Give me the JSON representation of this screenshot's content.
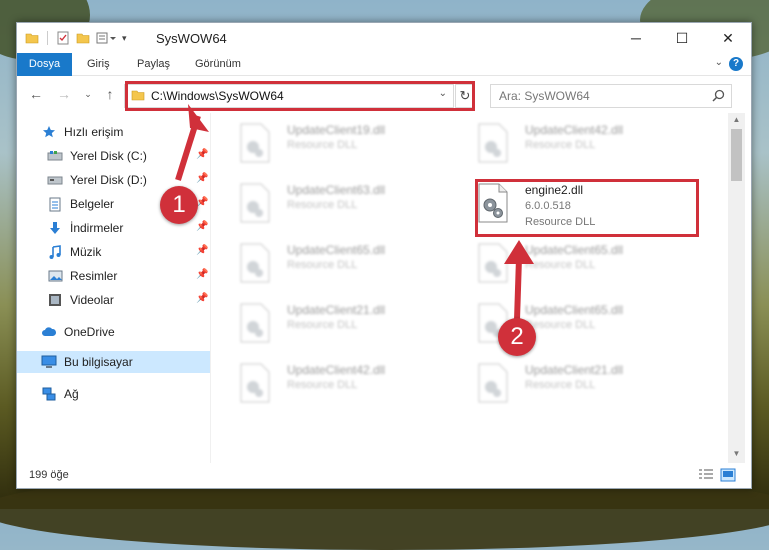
{
  "window": {
    "title": "SysWOW64",
    "controls": {
      "minimize": "─",
      "maximize": "☐",
      "close": "✕"
    }
  },
  "ribbon": {
    "tabs": [
      {
        "label": "Dosya"
      },
      {
        "label": "Giriş"
      },
      {
        "label": "Paylaş"
      },
      {
        "label": "Görünüm"
      }
    ],
    "help": "?"
  },
  "navigation": {
    "address": "C:\\Windows\\SysWOW64",
    "search_placeholder": "Ara: SysWOW64"
  },
  "sidebar": {
    "items": [
      {
        "label": "Hızlı erişim",
        "icon": "star-icon"
      },
      {
        "label": "Yerel Disk (C:)",
        "icon": "drive-icon"
      },
      {
        "label": "Yerel Disk (D:)",
        "icon": "drive-icon"
      },
      {
        "label": "Belgeler",
        "icon": "documents-icon"
      },
      {
        "label": "İndirmeler",
        "icon": "download-icon"
      },
      {
        "label": "Müzik",
        "icon": "music-icon"
      },
      {
        "label": "Resimler",
        "icon": "pictures-icon"
      },
      {
        "label": "Videolar",
        "icon": "video-icon"
      },
      {
        "label": "OneDrive",
        "icon": "cloud-icon"
      },
      {
        "label": "Bu bilgisayar",
        "icon": "computer-icon"
      },
      {
        "label": "Ağ",
        "icon": "network-icon"
      }
    ]
  },
  "files": {
    "left": [
      {
        "name": "UpdateClient19.dll",
        "type": "Resource DLL"
      },
      {
        "name": "UpdateClient63.dll",
        "type": "Resource DLL"
      },
      {
        "name": "UpdateClient65.dll",
        "type": "Resource DLL"
      },
      {
        "name": "UpdateClient21.dll",
        "type": "Resource DLL"
      },
      {
        "name": "UpdateClient42.dll",
        "type": "Resource DLL"
      }
    ],
    "right": [
      {
        "name": "UpdateClient42.dll",
        "type": "Resource DLL"
      },
      {
        "name": "engine2.dll",
        "version": "6.0.0.518",
        "type": "Resource DLL"
      },
      {
        "name": "UpdateClient65.dll",
        "type": "Resource DLL"
      },
      {
        "name": "UpdateClient65.dll",
        "type": "Resource DLL"
      },
      {
        "name": "UpdateClient21.dll",
        "type": "Resource DLL"
      }
    ]
  },
  "annotations": {
    "step1": "1",
    "step2": "2",
    "color": "#d0303a"
  },
  "status": {
    "count": "199 öğe"
  }
}
